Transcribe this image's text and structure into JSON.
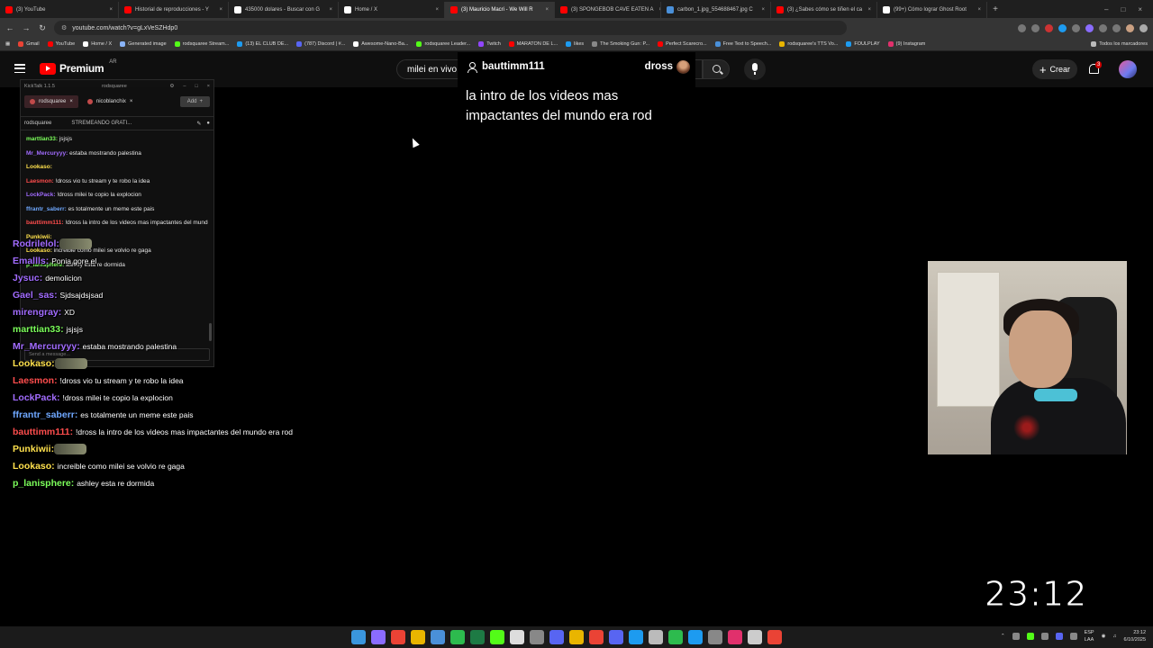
{
  "browser": {
    "tabs": [
      {
        "label": "(3) YouTube",
        "color": "#ff0000",
        "active": false
      },
      {
        "label": "Historial de reproducciones - Y",
        "color": "#ff0000",
        "active": false
      },
      {
        "label": "435000 dolares - Buscar con G",
        "color": "#ffffff",
        "active": false
      },
      {
        "label": "Home / X",
        "color": "#ffffff",
        "active": false
      },
      {
        "label": "(3) Mauricio Macri - We Will R",
        "color": "#ff0000",
        "active": true
      },
      {
        "label": "(3) SPONGEBOB CAVE EATEN A",
        "color": "#ff0000",
        "active": false
      },
      {
        "label": "carbon_1.jpg_554688467.jpg C",
        "color": "#4a90d9",
        "active": false
      },
      {
        "label": "(3) ¿Sabes cómo se tiñen el ca",
        "color": "#ff0000",
        "active": false
      },
      {
        "label": "(99+) Cómo lograr Ghost Root",
        "color": "#ffffff",
        "active": false
      }
    ],
    "new_tab": "+",
    "url": "youtube.com/watch?v=gLxVeSZHdp0",
    "bookmarks": [
      {
        "label": "Gmail",
        "color": "#ea4335"
      },
      {
        "label": "YouTube",
        "color": "#ff0000"
      },
      {
        "label": "Home / X",
        "color": "#ffffff"
      },
      {
        "label": "Generated image",
        "color": "#8ab4f8"
      },
      {
        "label": "rodsquaree Stream...",
        "color": "#53fc18"
      },
      {
        "label": "(13) EL CLUB DE...",
        "color": "#1d9bf0"
      },
      {
        "label": "(787) Discord | #...",
        "color": "#5865f2"
      },
      {
        "label": "Awesome-Nano-Ba...",
        "color": "#ffffff"
      },
      {
        "label": "rodsquaree Leader...",
        "color": "#53fc18"
      },
      {
        "label": "Twitch",
        "color": "#9146ff"
      },
      {
        "label": "MARATON DE L...",
        "color": "#ff0000"
      },
      {
        "label": "likes",
        "color": "#1d9bf0"
      },
      {
        "label": "The Smoking Gun: P...",
        "color": "#888888"
      },
      {
        "label": "Perfect Scarecro...",
        "color": "#ff0000"
      },
      {
        "label": "Free Text to Speech...",
        "color": "#4a90d9"
      },
      {
        "label": "rodsquaree's TTS Vo...",
        "color": "#e9b500"
      },
      {
        "label": "FOULPLAY",
        "color": "#1d9bf0"
      },
      {
        "label": "(9) Instagram",
        "color": "#e1306c"
      }
    ],
    "all_bookmarks": "Todos los marcadores"
  },
  "youtube": {
    "logo_word": "Premium",
    "country": "AR",
    "search_value": "milei en vivo",
    "create_label": "Crear",
    "notification_count": "3"
  },
  "kicktalk": {
    "app_title": "KickTalk 1.1.5",
    "user": "rodsquaree",
    "tabs": [
      "rodsquaree",
      "nicoblanchix"
    ],
    "add_label": "Add",
    "channel": "rodsquaree",
    "stream_title": "STREMEANDO GRATI...",
    "messages": [
      {
        "user": "marttian33:",
        "color": "#7cff5b",
        "text": "jsjsjs"
      },
      {
        "user": "Mr_Mercuryyy:",
        "color": "#a26cff",
        "text": "estaba mostrando palestina"
      },
      {
        "user": "Lookaso:",
        "color": "#ffe14d",
        "text": ""
      },
      {
        "user": "Laesmon:",
        "color": "#ff4d4d",
        "text": "!dross vio tu stream y te robo la idea"
      },
      {
        "user": "LockPack:",
        "color": "#a26cff",
        "text": "!dross milei te copio la explocion"
      },
      {
        "user": "ffrantr_saberr:",
        "color": "#6fa8ff",
        "text": "es totalmente un meme este pais"
      },
      {
        "user": "bauttimm111:",
        "color": "#ff4d4d",
        "text": "!dross la intro de los videos mas impactantes del mundo era rod"
      },
      {
        "user": "Punkiwii:",
        "color": "#ffe14d",
        "text": ""
      },
      {
        "user": "Lookaso:",
        "color": "#ffe14d",
        "text": "increible como milei se volvio re gaga"
      },
      {
        "user": "p_lanisphere:",
        "color": "#7cff5b",
        "text": "ashley esta re dormida"
      }
    ],
    "input_placeholder": "Send a message..."
  },
  "overlay_chat": [
    {
      "user": "Rodrilelol:",
      "color": "#a26cff",
      "text": ""
    },
    {
      "user": "Emallls:",
      "color": "#a26cff",
      "text": "Ponia gore el"
    },
    {
      "user": "Jysuc:",
      "color": "#a26cff",
      "text": "demolicion"
    },
    {
      "user": "Gael_sas:",
      "color": "#a26cff",
      "text": "Sjdsajdsjsad"
    },
    {
      "user": "mirengray:",
      "color": "#a26cff",
      "text": "XD"
    },
    {
      "user": "marttian33:",
      "color": "#7cff5b",
      "text": "jsjsjs"
    },
    {
      "user": "Mr_Mercuryyy:",
      "color": "#a26cff",
      "text": "estaba mostrando palestina"
    },
    {
      "user": "Lookaso:",
      "color": "#ffe14d",
      "text": ""
    },
    {
      "user": "Laesmon:",
      "color": "#ff4d4d",
      "text": "!dross vio tu stream y te robo la idea"
    },
    {
      "user": "LockPack:",
      "color": "#a26cff",
      "text": "!dross milei te copio la explocion"
    },
    {
      "user": "ffrantr_saberr:",
      "color": "#6fa8ff",
      "text": "es totalmente un meme este pais"
    },
    {
      "user": "bauttimm111:",
      "color": "#ff4d4d",
      "text": "!dross la intro de los videos mas impactantes del mundo era rod"
    },
    {
      "user": "Punkiwii:",
      "color": "#ffe14d",
      "text": ""
    },
    {
      "user": "Lookaso:",
      "color": "#ffe14d",
      "text": "increible como milei se volvio re gaga"
    },
    {
      "user": "p_lanisphere:",
      "color": "#7cff5b",
      "text": "ashley esta re dormida"
    }
  ],
  "highlight": {
    "user": "bauttimm111",
    "channel": "dross",
    "text": "la intro de los videos mas impactantes del mundo era rod"
  },
  "timer": "23:12",
  "taskbar": {
    "apps": [
      {
        "icon": "windows-icon",
        "color": "#3a96dd"
      },
      {
        "icon": "copilot-icon",
        "color": "#8a6cff"
      },
      {
        "icon": "chrome-icon",
        "color": "#ea4335"
      },
      {
        "icon": "explorer-icon",
        "color": "#e9b500"
      },
      {
        "icon": "steam-icon",
        "color": "#4a90d9"
      },
      {
        "icon": "xbox-icon",
        "color": "#2dbb4e"
      },
      {
        "icon": "excel-icon",
        "color": "#1d7a44"
      },
      {
        "icon": "kick-icon",
        "color": "#53fc18"
      },
      {
        "icon": "obs-icon",
        "color": "#dddddd"
      },
      {
        "icon": "media-icon",
        "color": "#888888"
      },
      {
        "icon": "vs-icon",
        "color": "#5865f2"
      },
      {
        "icon": "notes-icon",
        "color": "#e9b500"
      },
      {
        "icon": "app-icon",
        "color": "#ea4335"
      },
      {
        "icon": "discord-icon",
        "color": "#5865f2"
      },
      {
        "icon": "edge-icon",
        "color": "#1d9bf0"
      },
      {
        "icon": "app-icon",
        "color": "#bbbbbb"
      },
      {
        "icon": "app-icon",
        "color": "#2dbb4e"
      },
      {
        "icon": "app-icon",
        "color": "#1d9bf0"
      },
      {
        "icon": "app-icon",
        "color": "#888888"
      },
      {
        "icon": "app-icon",
        "color": "#e1306c"
      },
      {
        "icon": "terminal-icon",
        "color": "#cccccc"
      },
      {
        "icon": "chrome-icon",
        "color": "#ea4335"
      }
    ],
    "lang_top": "ESP",
    "lang_bottom": "LAA",
    "time": "23:12",
    "date": "6/10/2025"
  }
}
